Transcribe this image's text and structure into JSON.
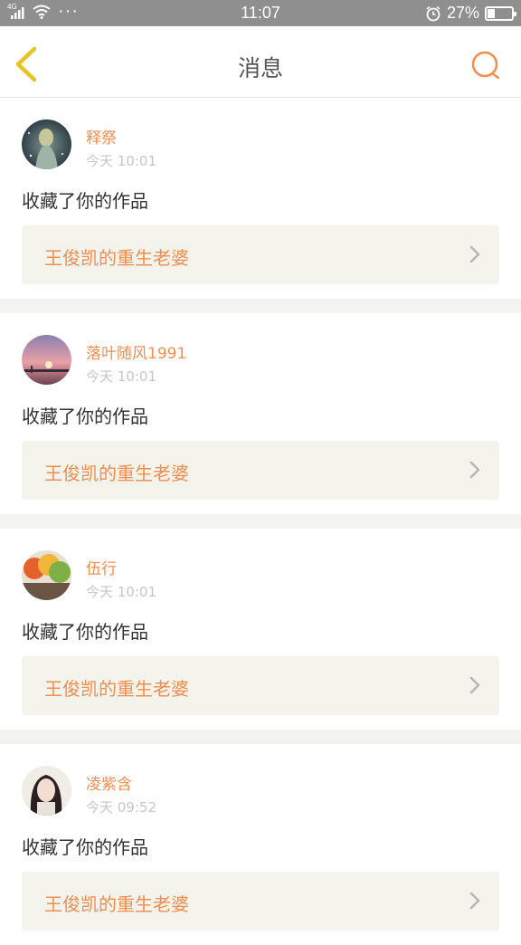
{
  "status_bar": {
    "network": "4G",
    "dots": "···",
    "time": "11:07",
    "battery_percent": "27%",
    "battery_level": 0.27
  },
  "header": {
    "title": "消息",
    "back_icon": "chevron-left-icon",
    "search_icon": "search-icon"
  },
  "colors": {
    "accent": "#ee8f54",
    "back_icon": "#e6c423",
    "card_bg": "#ffffff",
    "work_bg": "#f4f3ec"
  },
  "messages": [
    {
      "username": "释祭",
      "time": "今天 10:01",
      "action": "收藏了你的作品",
      "work_title": "王俊凯的重生老婆"
    },
    {
      "username": "落叶随风1991",
      "time": "今天 10:01",
      "action": "收藏了你的作品",
      "work_title": "王俊凯的重生老婆"
    },
    {
      "username": "伍行",
      "time": "今天 10:01",
      "action": "收藏了你的作品",
      "work_title": "王俊凯的重生老婆"
    },
    {
      "username": "凌紫含",
      "time": "今天 09:52",
      "action": "收藏了你的作品",
      "work_title": "王俊凯的重生老婆"
    }
  ]
}
